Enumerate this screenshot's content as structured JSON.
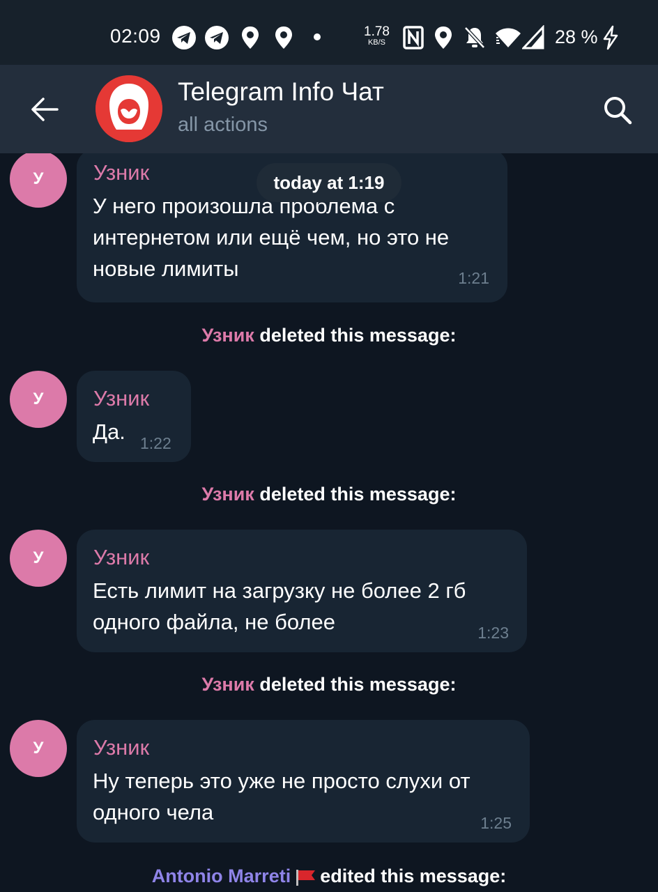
{
  "status_bar": {
    "time": "02:09",
    "net_speed_value": "1.78",
    "net_speed_unit": "KB/S",
    "battery": "28 %",
    "icons": [
      "telegram-icon",
      "telegram-icon",
      "location-icon",
      "location-icon",
      "nfc-icon",
      "location-icon",
      "mute-icon",
      "wifi-icon",
      "signal-icon",
      "charging-icon"
    ]
  },
  "header": {
    "title": "Telegram Info Чат",
    "subtitle": "all actions",
    "back_icon": "back-arrow-icon",
    "search_icon": "search-icon"
  },
  "chat": {
    "date_pill": "today at 1:19",
    "messages": [
      {
        "avatar_letter": "У",
        "sender": "Узник",
        "lines": [
          "У него произошла проблема с",
          "интернетом или ещё чем, но это не",
          "новые лимиты"
        ],
        "time": "1:21"
      },
      {
        "avatar_letter": "У",
        "sender": "Узник",
        "lines": [
          "Да."
        ],
        "time": "1:22"
      },
      {
        "avatar_letter": "У",
        "sender": "Узник",
        "lines": [
          "Есть лимит на загрузку не более 2 гб",
          "одного файла, не более"
        ],
        "time": "1:23"
      },
      {
        "avatar_letter": "У",
        "sender": "Узник",
        "lines": [
          "Ну теперь это уже не просто слухи от",
          "одного чела"
        ],
        "time": "1:25"
      }
    ],
    "service_messages": [
      {
        "actor": "Узник",
        "action": "deleted this message:"
      },
      {
        "actor": "Узник",
        "action": "deleted this message:"
      },
      {
        "actor": "Узник",
        "action": "deleted this message:"
      },
      {
        "actor": "Antonio Marreti",
        "action": "edited this message:"
      }
    ]
  },
  "colors": {
    "chat_background": "#0e1621",
    "header_background": "#232e3c",
    "bubble": "#182533",
    "sender_name": "#dc7aa9",
    "avatar": "#dc7aa9",
    "editor_name": "#8f84e8",
    "app_avatar": "#e53935"
  }
}
